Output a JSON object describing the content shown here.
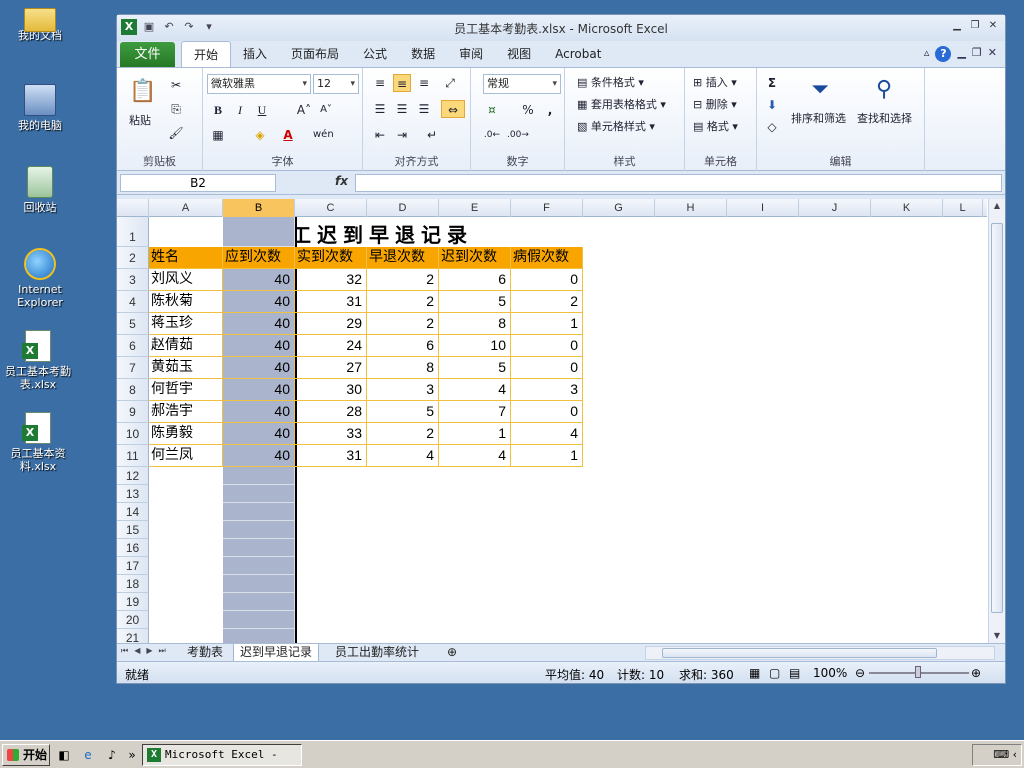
{
  "desktop": {
    "icons": [
      {
        "label": "我的文档",
        "icon": "folder-icon"
      },
      {
        "label": "我的电脑",
        "icon": "computer-icon"
      },
      {
        "label": "回收站",
        "icon": "recycle-bin-icon"
      },
      {
        "label": "Internet Explorer",
        "icon": "ie-icon"
      },
      {
        "label": "员工基本考勤表.xlsx",
        "icon": "excel-file-icon"
      },
      {
        "label": "员工基本资料.xlsx",
        "icon": "excel-file-icon"
      }
    ]
  },
  "window": {
    "title": "员工基本考勤表.xlsx - Microsoft Excel"
  },
  "ribbon": {
    "file_tab": "文件",
    "tabs": [
      "开始",
      "插入",
      "页面布局",
      "公式",
      "数据",
      "审阅",
      "视图",
      "Acrobat"
    ],
    "active_tab": "开始",
    "clipboard": {
      "name": "剪贴板",
      "paste": "粘贴"
    },
    "font": {
      "name": "字体",
      "family": "微软雅黑",
      "size": "12",
      "bold": "B",
      "italic": "I",
      "underline": "U"
    },
    "alignment": {
      "name": "对齐方式"
    },
    "number": {
      "name": "数字",
      "format": "常规",
      "percent": "%",
      "comma": ","
    },
    "styles": {
      "name": "样式",
      "conditional": "条件格式",
      "table": "套用表格格式",
      "cell": "单元格样式"
    },
    "cells": {
      "name": "单元格",
      "insert": "插入",
      "delete": "删除",
      "format": "格式"
    },
    "editing": {
      "name": "编辑",
      "sort": "排序和筛选",
      "find": "查找和选择",
      "sum": "Σ"
    }
  },
  "formula_bar": {
    "name_box": "B2",
    "fx": "fx",
    "value": ""
  },
  "columns": [
    "A",
    "B",
    "C",
    "D",
    "E",
    "F",
    "G",
    "H",
    "I",
    "J",
    "K",
    "L"
  ],
  "sheet": {
    "title": "员工迟到早退记录",
    "headers": [
      "姓名",
      "应到次数",
      "实到次数",
      "早退次数",
      "迟到次数",
      "病假次数"
    ],
    "rows": [
      [
        "刘风义",
        "40",
        "32",
        "2",
        "6",
        "0"
      ],
      [
        "陈秋菊",
        "40",
        "31",
        "2",
        "5",
        "2"
      ],
      [
        "蒋玉珍",
        "40",
        "29",
        "2",
        "8",
        "1"
      ],
      [
        "赵倩茹",
        "40",
        "24",
        "6",
        "10",
        "0"
      ],
      [
        "黄茹玉",
        "40",
        "27",
        "8",
        "5",
        "0"
      ],
      [
        "何哲宇",
        "40",
        "30",
        "3",
        "4",
        "3"
      ],
      [
        "郝浩宇",
        "40",
        "28",
        "5",
        "7",
        "0"
      ],
      [
        "陈勇毅",
        "40",
        "33",
        "2",
        "1",
        "4"
      ],
      [
        "何兰凤",
        "40",
        "31",
        "4",
        "4",
        "1"
      ]
    ],
    "row_numbers": [
      "1",
      "2",
      "3",
      "4",
      "5",
      "6",
      "7",
      "8",
      "9",
      "10",
      "11",
      "12",
      "13",
      "14",
      "15",
      "16",
      "17",
      "18",
      "19",
      "20",
      "21"
    ]
  },
  "sheet_tabs": [
    "考勤表",
    "迟到早退记录",
    "员工出勤率统计"
  ],
  "active_sheet": "迟到早退记录",
  "status": {
    "ready": "就绪",
    "average": "平均值: 40",
    "count": "计数: 10",
    "sum": "求和: 360",
    "zoom": "100%"
  },
  "taskbar": {
    "start": "开始",
    "task": "Microsoft Excel - ..."
  },
  "colors": {
    "header_fill": "#f9a500",
    "selection": "#aab4cc",
    "accent_green": "#1e7b34"
  }
}
